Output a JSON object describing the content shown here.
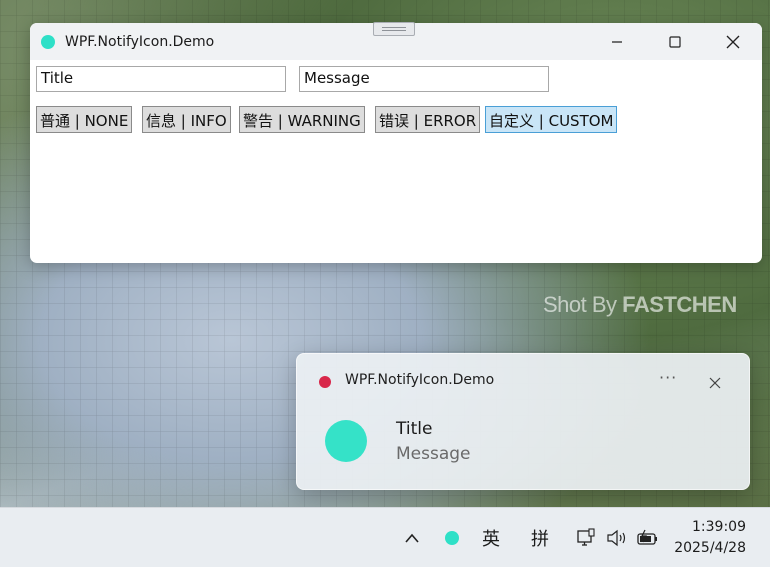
{
  "window": {
    "title": "WPF.NotifyIcon.Demo",
    "icon": "circle-icon",
    "accent_color": "#2ee0c7",
    "controls": {
      "minimize": "minimize-icon",
      "maximize": "maximize-icon",
      "close": "close-icon"
    }
  },
  "form": {
    "title_value": "Title",
    "message_value": "Message",
    "buttons": [
      "普通 | NONE",
      "信息 | INFO",
      "警告 | WARNING",
      "错误 | ERROR",
      "自定义 | CUSTOM"
    ]
  },
  "watermark": {
    "prefix": "Shot By ",
    "brand": "FASTCHEN"
  },
  "toast": {
    "app_name": "WPF.NotifyIcon.Demo",
    "app_dot_color": "#d8274a",
    "more": "···",
    "title": "Title",
    "message": "Message",
    "icon_color": "#35e2c8"
  },
  "taskbar": {
    "ime_lang": "英",
    "ime_mode": "拼",
    "time": "1:39:09",
    "date": "2025/4/28"
  }
}
